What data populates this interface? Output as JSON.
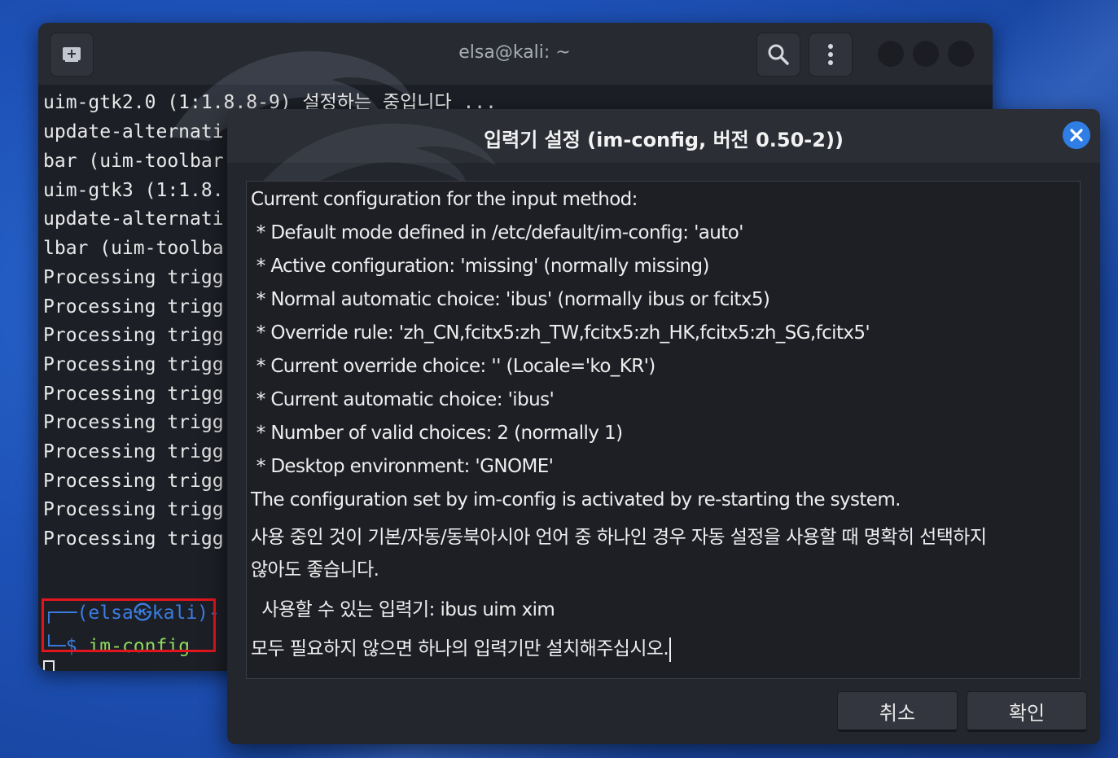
{
  "terminal": {
    "title": "elsa@kali: ~",
    "lines": [
      "uim-gtk2.0 (1:1.8.8-9) 설정하는 중입니다 ...",
      "update-alternati",
      "bar (uim-toolbar",
      "uim-gtk3 (1:1.8.",
      "update-alternati",
      "lbar (uim-toolba",
      "Processing trigg",
      "Processing trigg",
      "Processing trigg",
      "Processing trigg",
      "Processing trigg",
      "Processing trigg",
      "Processing trigg",
      "Processing trigg",
      "Processing trigg",
      "Processing trigg"
    ],
    "prompt_user": "┌──(elsa㉿kali)-",
    "prompt_branch": "└─",
    "prompt_symbol": "$",
    "command": "im-config",
    "icons": {
      "new_tab": "new-tab-icon",
      "search": "search-icon",
      "menu": "kebab-menu-icon"
    }
  },
  "dialog": {
    "title": "입력기 설정 (im-config, 버전 0.50-2))",
    "lines": [
      "Current configuration for the input method:",
      " * Default mode defined in /etc/default/im-config: 'auto'",
      " * Active configuration: 'missing' (normally missing)",
      " * Normal automatic choice: 'ibus' (normally ibus or fcitx5)",
      " * Override rule: 'zh_CN,fcitx5:zh_TW,fcitx5:zh_HK,fcitx5:zh_SG,fcitx5'",
      " * Current override choice: '' (Locale='ko_KR')",
      " * Current automatic choice: 'ibus'",
      " * Number of valid choices: 2 (normally 1)",
      " * Desktop environment: 'GNOME'",
      "The configuration set by im-config is activated by re-starting the system.",
      "사용 중인 것이 기본/자동/동북아시아 언어 중 하나인 경우 자동 설정을 사용할 때 명확히 선택하지",
      "않아도 좋습니다.",
      "  사용할 수 있는 입력기: ibus uim xim",
      "모두 필요하지 않으면 하나의 입력기만 설치해주십시오."
    ],
    "cancel_label": "취소",
    "ok_label": "확인",
    "accent_color": "#2f7ee6"
  },
  "highlight_color": "#e0151d"
}
